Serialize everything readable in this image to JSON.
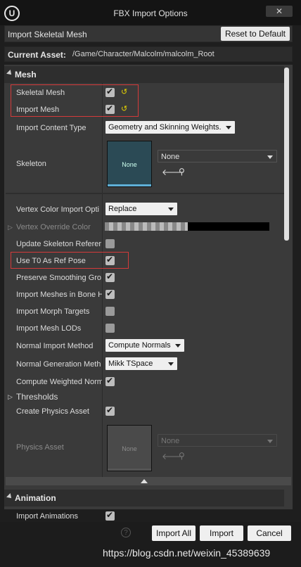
{
  "window": {
    "title": "FBX Import Options",
    "logo": "U",
    "close": "✕"
  },
  "header": {
    "title": "Import Skeletal Mesh",
    "reset_label": "Reset to Default"
  },
  "asset": {
    "label": "Current Asset:",
    "path": "/Game/Character/Malcolm/malcolm_Root"
  },
  "mesh_section": {
    "title": "Mesh"
  },
  "rows": {
    "skeletal_mesh": "Skeletal Mesh",
    "import_mesh": "Import Mesh",
    "import_content_type": "Import Content Type",
    "skeleton": "Skeleton",
    "vertex_color_import": "Vertex Color Import Opti",
    "vertex_override_color": "Vertex Override Color",
    "update_skeleton": "Update Skeleton Referer",
    "use_t0": "Use T0 As Ref Pose",
    "preserve_smoothing": "Preserve Smoothing Gro",
    "import_meshes_bone": "Import Meshes in Bone H",
    "import_morph": "Import Morph Targets",
    "import_lods": "Import Mesh LODs",
    "normal_import": "Normal Import Method",
    "normal_generation": "Normal Generation Meth",
    "compute_weighted": "Compute Weighted Norm",
    "thresholds": "Thresholds",
    "create_physics": "Create Physics Asset",
    "physics_asset": "Physics Asset"
  },
  "values": {
    "import_content_type": "Geometry and Skinning Weights.",
    "skeleton_thumb": "None",
    "skeleton_select": "None",
    "vertex_color_import": "Replace",
    "normal_import": "Compute Normals",
    "normal_generation": "Mikk TSpace",
    "physics_thumb": "None",
    "physics_select": "None"
  },
  "animation_section": {
    "title": "Animation",
    "import_animations": "Import Animations"
  },
  "buttons": {
    "import_all": "Import All",
    "import": "Import",
    "cancel": "Cancel"
  },
  "help_icon": "?",
  "watermark": "https://blog.csdn.net/weixin_45389639",
  "colors": {
    "highlight_box": "#d43a3a",
    "reset_arrow": "#e6d300",
    "thumb": "#2b4a55"
  }
}
